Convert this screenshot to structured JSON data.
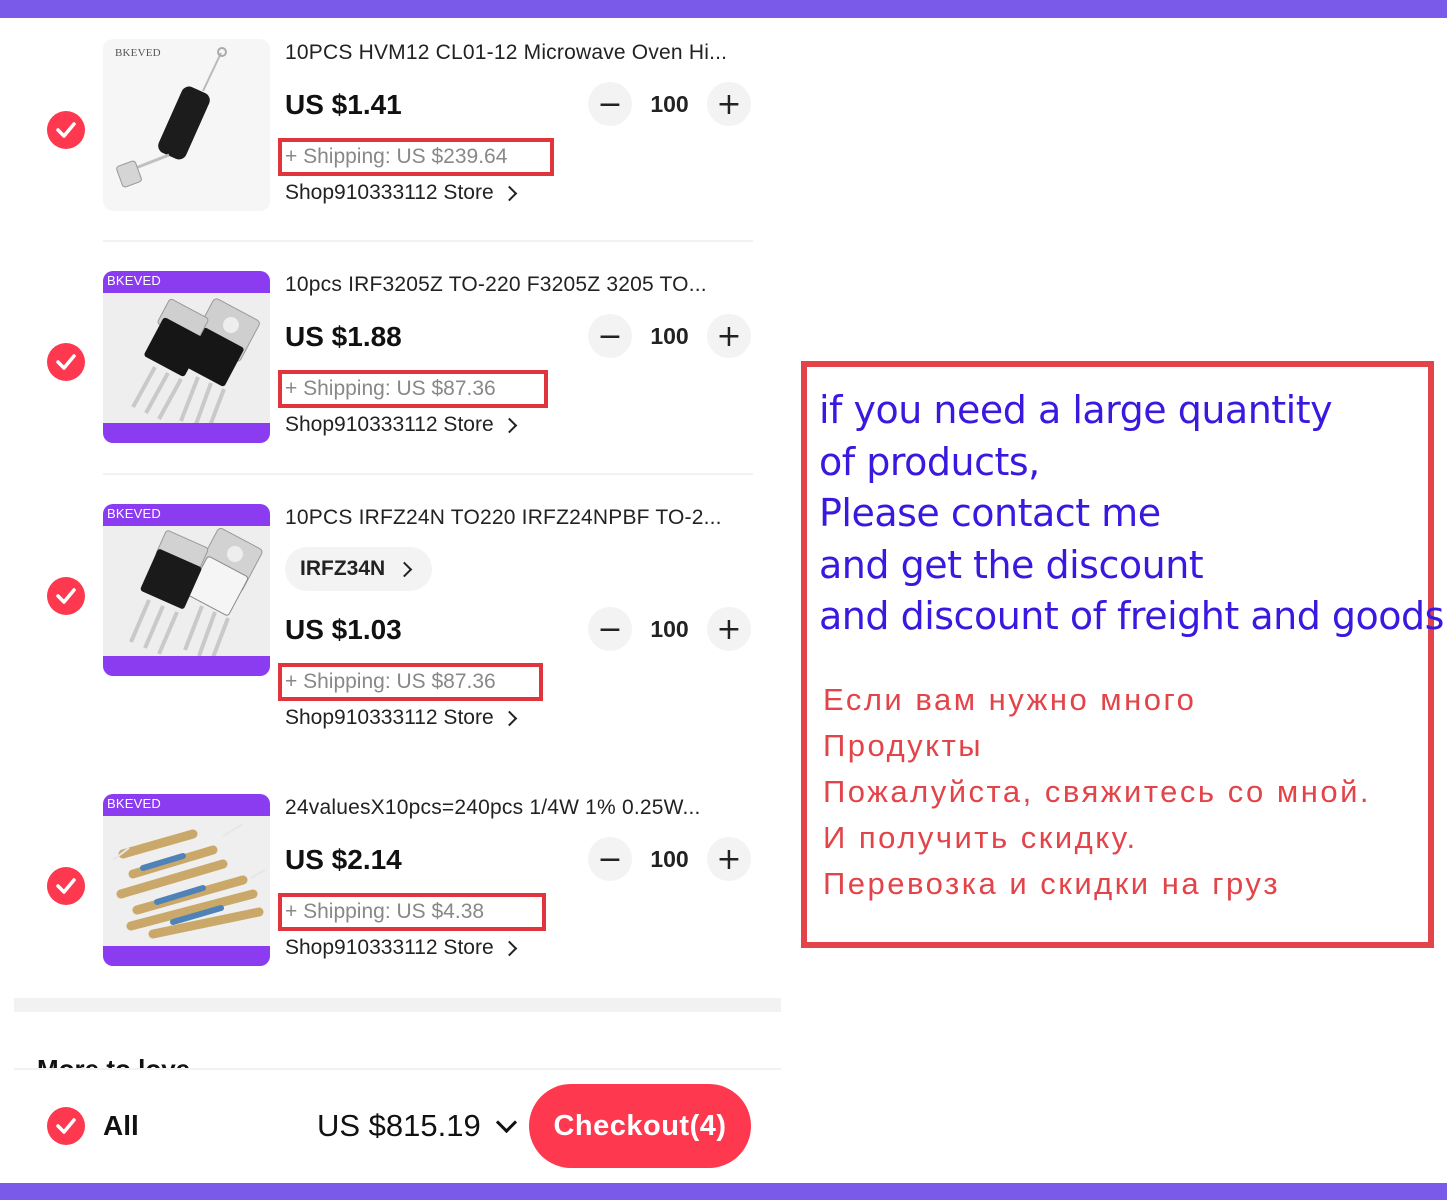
{
  "colors": {
    "accent": "#fd384f",
    "frame": "#7a5ae8",
    "shipping_box": "#e0353c",
    "promo_en": "#3a18e0",
    "promo_ru": "#e2444a",
    "thumb_banner": "#8b3cf0"
  },
  "items": [
    {
      "brand": "BKEVED",
      "title": "10PCS HVM12 CL01-12 Microwave Oven Hi...",
      "price": "US $1.41",
      "quantity": "100",
      "shipping": "+ Shipping:  US $239.64",
      "store": "Shop910333112 Store",
      "checked": true,
      "icon": "check-icon"
    },
    {
      "brand": "BKEVED",
      "title": "10pcs IRF3205Z TO-220 F3205Z 3205 TO...",
      "price": "US $1.88",
      "quantity": "100",
      "shipping": "+ Shipping:  US $87.36",
      "store": "Shop910333112 Store",
      "checked": true,
      "icon": "check-icon"
    },
    {
      "brand": "BKEVED",
      "title": "10PCS IRFZ24N TO220 IRFZ24NPBF TO-2...",
      "variant": "IRFZ34N",
      "price": "US $1.03",
      "quantity": "100",
      "shipping": "+ Shipping:  US $87.36",
      "store": "Shop910333112 Store",
      "checked": true,
      "icon": "check-icon"
    },
    {
      "brand": "BKEVED",
      "title": "24valuesX10pcs=240pcs 1/4W 1% 0.25W...",
      "price": "US $2.14",
      "quantity": "100",
      "shipping": "+ Shipping:  US $4.38",
      "store": "Shop910333112 Store",
      "checked": true,
      "icon": "check-icon"
    }
  ],
  "more_section": "More to love",
  "footer": {
    "all_label": "All",
    "total": "US $815.19",
    "checkout_label": "Checkout(4)"
  },
  "promo": {
    "english_lines": [
      "if you need a large quantity",
      "of products,",
      "Please contact me",
      "and get the discount",
      "and discount of freight and goods,"
    ],
    "russian_lines": [
      "Если вам нужно много",
      "Продукты",
      "Пожалуйста, свяжитесь со мной.",
      "И получить скидку.",
      "Перевозка и скидки на груз"
    ]
  }
}
